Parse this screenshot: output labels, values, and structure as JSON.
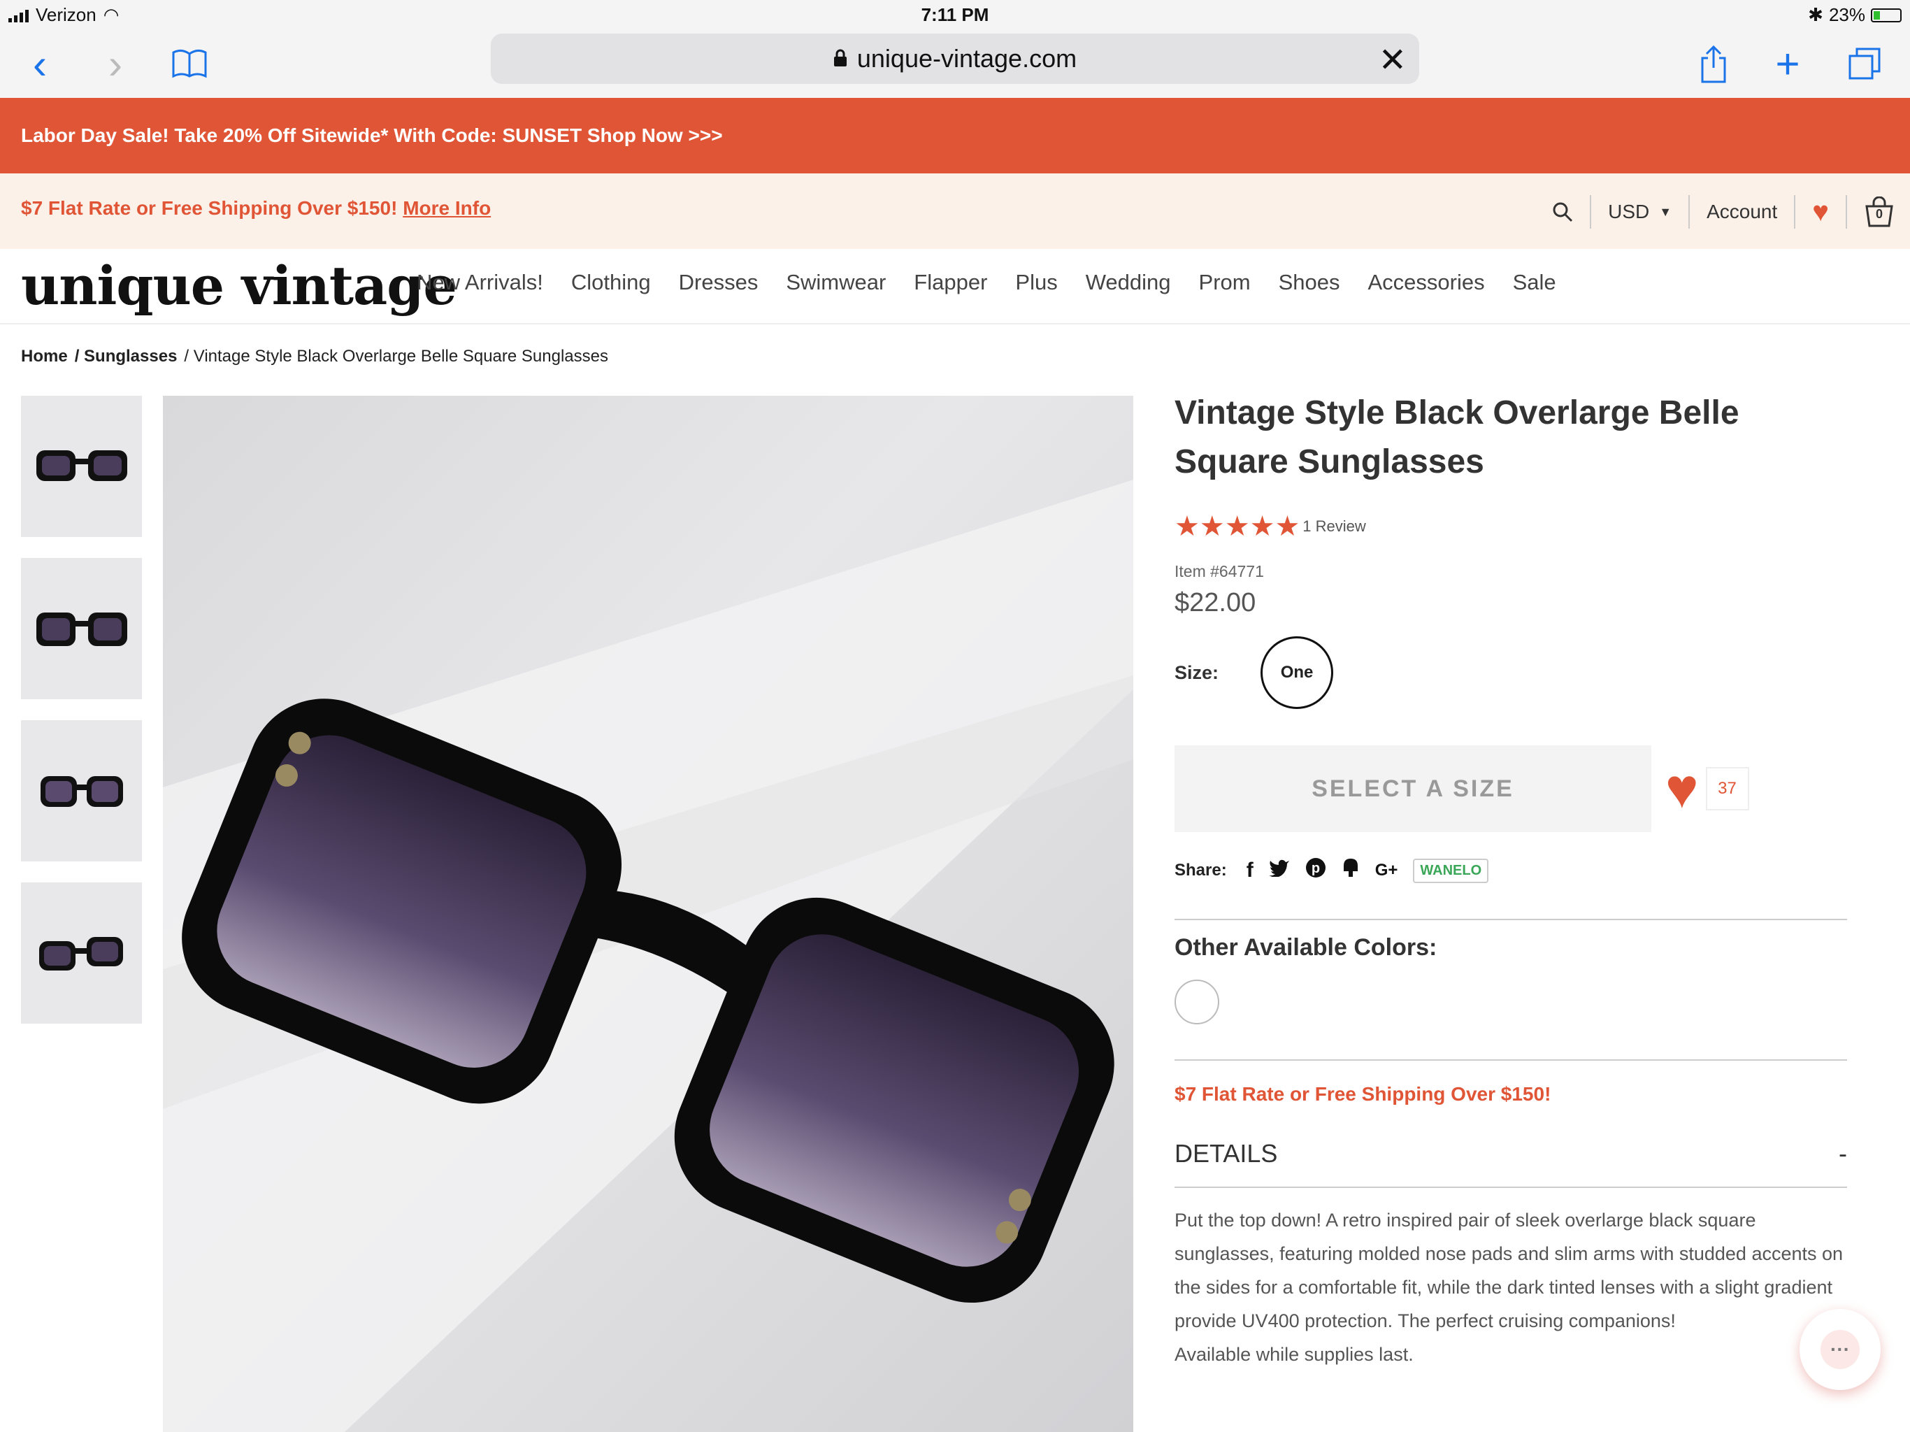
{
  "status": {
    "carrier": "Verizon",
    "time": "7:11 PM",
    "battery": "23%"
  },
  "safari": {
    "url": "unique-vintage.com"
  },
  "promo": {
    "text": "Labor Day Sale! Take 20% Off Sitewide* With Code: SUNSET Shop Now >>>"
  },
  "shipping_bar": {
    "text": "$7 Flat Rate or Free Shipping Over $150!",
    "link": "More Info"
  },
  "utility": {
    "currency": "USD",
    "account": "Account",
    "cart_count": "0"
  },
  "logo": "unique vintage",
  "nav": [
    "New Arrivals!",
    "Clothing",
    "Dresses",
    "Swimwear",
    "Flapper",
    "Plus",
    "Wedding",
    "Prom",
    "Shoes",
    "Accessories",
    "Sale"
  ],
  "breadcrumb": {
    "home": "Home",
    "category": "/ Sunglasses",
    "current": "/ Vintage Style Black Overlarge Belle Square Sunglasses"
  },
  "product": {
    "title": "Vintage Style Black Overlarge Belle Square Sunglasses",
    "stars": "★★★★★",
    "reviews": "1 Review",
    "item_no": "Item #64771",
    "price": "$22.00",
    "size_label": "Size:",
    "size_option": "One",
    "select_button": "SELECT A SIZE",
    "wish_count": "37",
    "share_label": "Share:",
    "share_wanelo": "WANELO",
    "colors_heading": "Other Available Colors:",
    "shipping_note": "$7 Flat Rate or Free Shipping Over $150!",
    "details_heading": "DETAILS",
    "details_toggle": "-",
    "description": "Put the top down! A retro inspired pair of sleek overlarge black square sunglasses, featuring molded nose pads and slim arms with studded accents on the sides for a comfortable fit, while the dark tinted lenses with a slight gradient provide UV400 protection. The perfect cruising companions!",
    "availability": "Available while supplies last."
  }
}
